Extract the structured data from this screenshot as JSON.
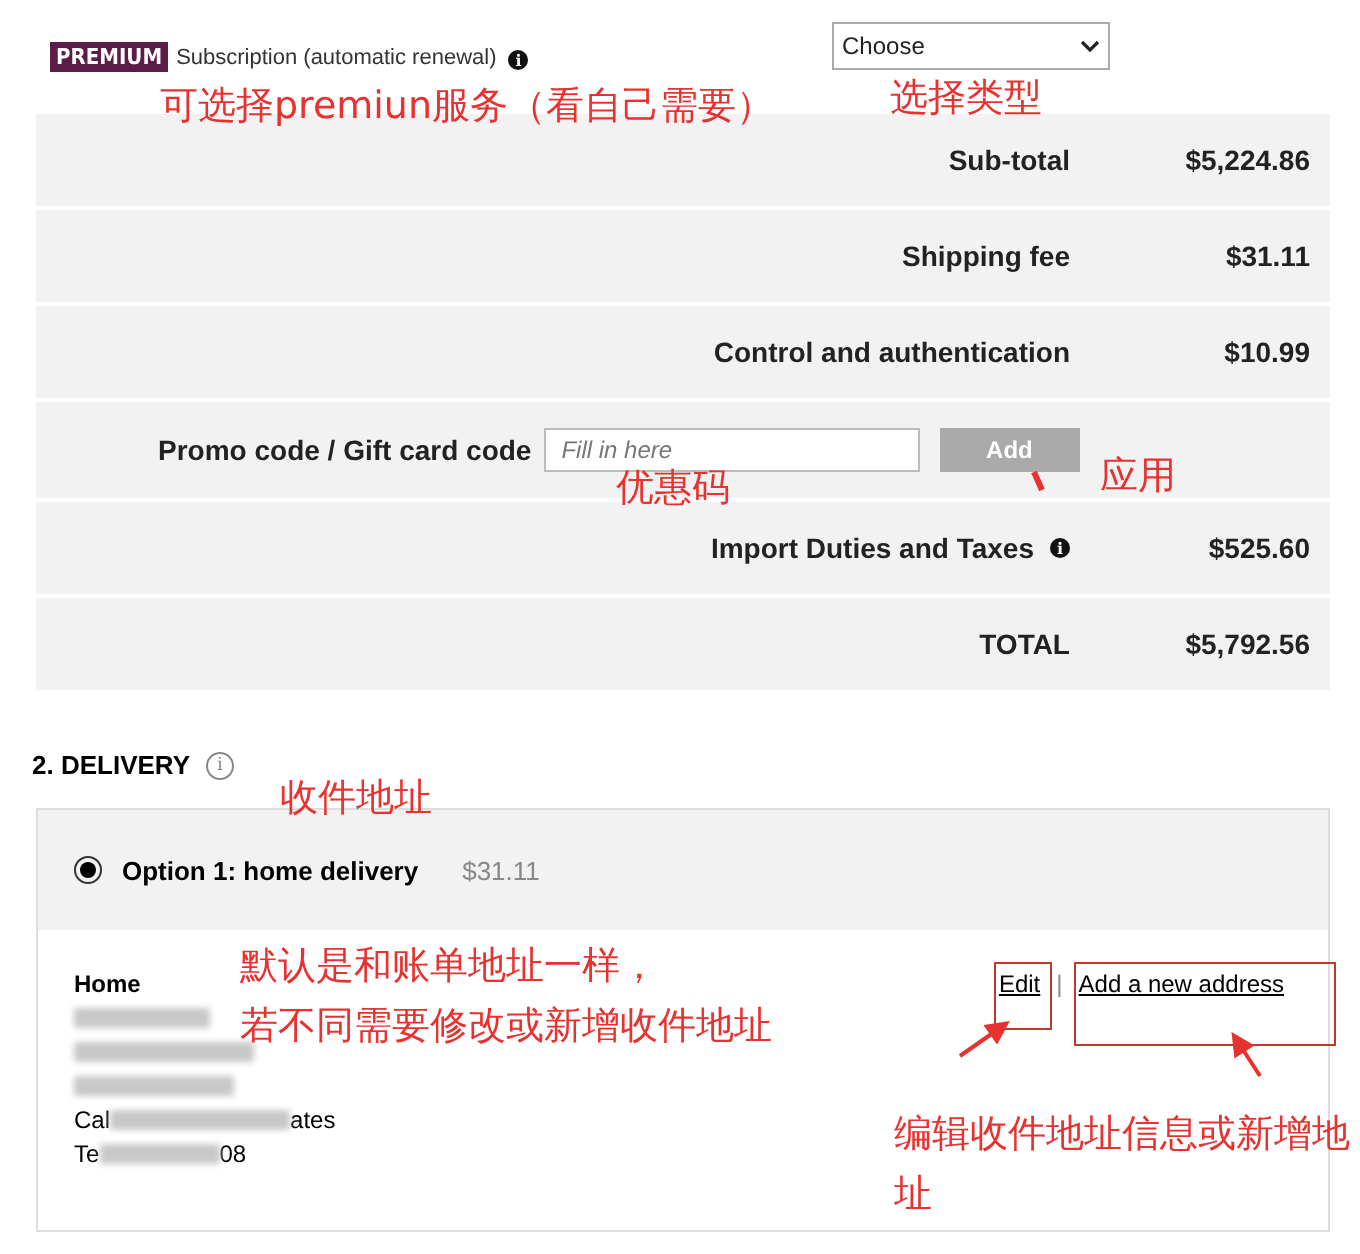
{
  "subscription": {
    "badge": "PREMIUM",
    "label": "Subscription (automatic renewal)",
    "info_icon": "i",
    "select": "Choose"
  },
  "summary": [
    {
      "kind": "line",
      "label": "Sub-total",
      "value": "$5,224.86"
    },
    {
      "kind": "line",
      "label": "Shipping fee",
      "value": "$31.11"
    },
    {
      "kind": "line",
      "label": "Control and authentication",
      "value": "$10.99"
    },
    {
      "kind": "promo",
      "label": "Promo code / Gift card code",
      "placeholder": "Fill in here",
      "button": "Add"
    },
    {
      "kind": "info",
      "label": "Import Duties and Taxes",
      "info_icon": "i",
      "value": "$525.60"
    },
    {
      "kind": "total",
      "label": "TOTAL",
      "value": "$5,792.56"
    }
  ],
  "delivery": {
    "heading": "2. DELIVERY",
    "info_icon": "i",
    "option": {
      "label": "Option 1: home delivery",
      "price": "$31.11",
      "selected": true
    },
    "address": {
      "title": "Home",
      "lines": [
        {
          "kind": "blurred"
        },
        {
          "kind": "blurred"
        },
        {
          "kind": "blurred"
        },
        {
          "kind": "partial",
          "start": "Cal",
          "end": "ates"
        },
        {
          "kind": "partial",
          "start": "Te",
          "end": "08"
        }
      ]
    },
    "edit": "Edit",
    "separator": "|",
    "add_address": "Add a new address"
  },
  "annotations": [
    {
      "text": "可选择premiun服务（看自己需要）"
    },
    {
      "text": "选择类型"
    },
    {
      "text": "优惠码"
    },
    {
      "text": "应用"
    },
    {
      "text": "收件地址"
    },
    {
      "text": "默认是和账单地址一样，"
    },
    {
      "text": "若不同需要修改或新增收件地址"
    },
    {
      "text": "编辑收件地址信息或新增地址"
    }
  ]
}
